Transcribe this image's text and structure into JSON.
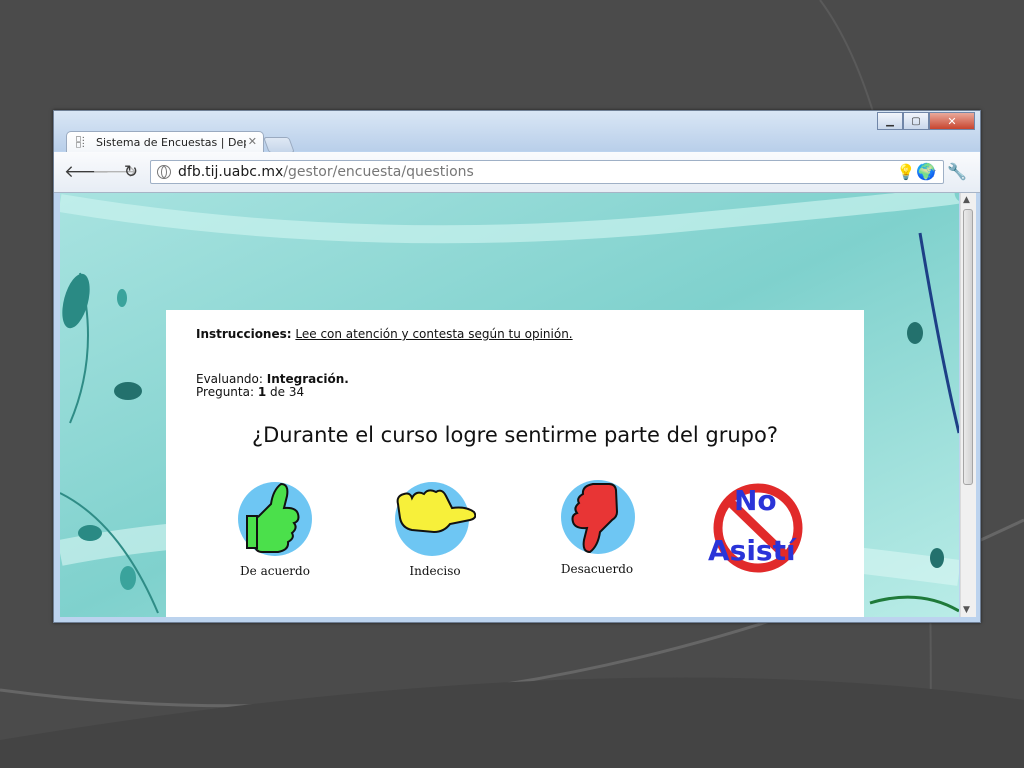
{
  "browser": {
    "tab_title": "Sistema de Encuestas | Depa",
    "url_host": "dfb.tij.uabc.mx",
    "url_path": "/gestor/encuesta/questions",
    "window_controls": [
      "minimize",
      "maximize",
      "close"
    ]
  },
  "survey": {
    "instructions_label": "Instrucciones:",
    "instructions_text": "Lee con atención y contesta según tu opinión.",
    "evaluating_label": "Evaluando:",
    "evaluating_value": "Integración.",
    "question_label": "Pregunta:",
    "question_number": "1",
    "question_of": "de",
    "question_total": "34",
    "question_text": "¿Durante el curso logre sentirme parte del grupo?",
    "options": [
      {
        "label": "De acuerdo",
        "icon": "thumbs-up-icon",
        "color": "#4be04b"
      },
      {
        "label": "Indeciso",
        "icon": "thumb-sideways-icon",
        "color": "#f7f03a"
      },
      {
        "label": "Desacuerdo",
        "icon": "thumbs-down-icon",
        "color": "#e83535"
      },
      {
        "label": "No Asistí",
        "icon": "no-attendance-icon",
        "color": "#2a34d8"
      }
    ]
  },
  "colors": {
    "slide_background": "#4a4a4a",
    "page_background": "#8fd6d3",
    "icon_circle": "#6ec6f3"
  }
}
